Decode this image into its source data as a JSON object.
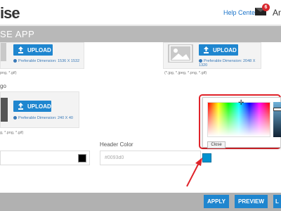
{
  "header": {
    "brand": "ise",
    "help_label": "Help Center",
    "mail_count": "6",
    "user_text": "Am"
  },
  "title": {
    "text": "SE APP"
  },
  "uploads": {
    "top_left": {
      "button": "UPLOAD",
      "pref_label": "Preferable Dimension:",
      "pref_value": "1536 X 1532"
    },
    "top_right": {
      "button": "UPLOAD",
      "pref_label": "Preferable Dimension:",
      "pref_value": "2048 X 1320",
      "formats": "(*.jpg, *.jpeg, *.png, *.gif)"
    },
    "middle": {
      "label": "go",
      "button": "UPLOAD",
      "pref_label": "Preferable Dimension:",
      "pref_value": "240 X 40",
      "formats": "g, *.png, *.gif)"
    },
    "top_left_formats": "png, *.gif)"
  },
  "colors": {
    "left_swatch": "#000000",
    "header_color_label": "Header Color",
    "header_color_value": "#0093d0",
    "header_swatch": "#0093d0"
  },
  "picker": {
    "close_label": "Close"
  },
  "actions": {
    "apply": "APPLY",
    "preview": "PREVIEW",
    "third": "L"
  }
}
